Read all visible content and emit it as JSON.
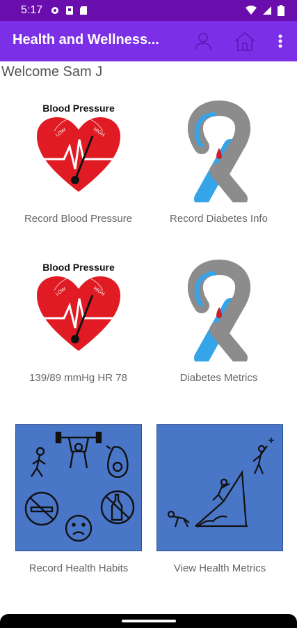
{
  "status": {
    "time": "5:17"
  },
  "appbar": {
    "title": "Health and Wellness..."
  },
  "welcome": "Welcome Sam J",
  "tiles": {
    "record_bp": {
      "label": "Record Blood Pressure",
      "image_caption": "Blood Pressure",
      "gauge_low": "LOW",
      "gauge_high": "HIGH"
    },
    "record_diabetes": {
      "label": "Record Diabetes Info"
    },
    "bp_reading": {
      "label": "139/89 mmHg  HR 78",
      "image_caption": "Blood Pressure",
      "gauge_low": "LOW",
      "gauge_high": "HIGH"
    },
    "diabetes_metrics": {
      "label": "Diabetes Metrics"
    },
    "health_habits": {
      "label": "Record Health Habits"
    },
    "view_metrics": {
      "label": "View Health Metrics"
    }
  },
  "colors": {
    "statusbar": "#6a0dad",
    "appbar": "#7b2fe6",
    "tile_blue": "#4a76c8",
    "heart_red": "#e01b24",
    "ribbon_gray": "#8c8c8c",
    "ribbon_blue": "#35a4e8"
  }
}
